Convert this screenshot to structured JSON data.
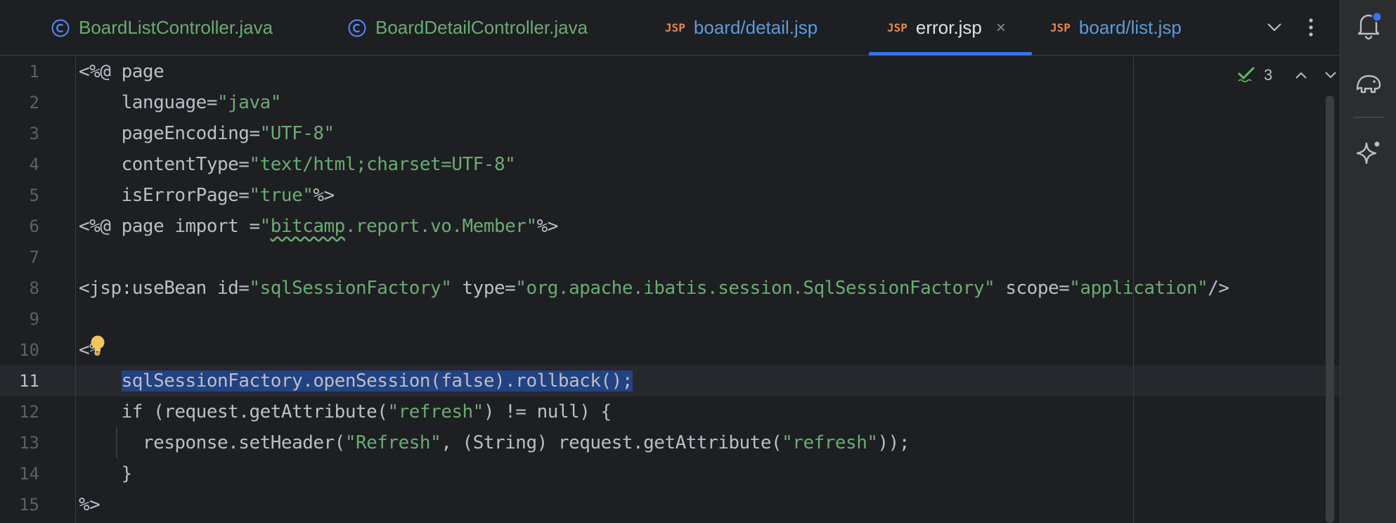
{
  "tabs": [
    {
      "label": "BoardListController.java",
      "type": "java"
    },
    {
      "label": "BoardDetailController.java",
      "type": "java"
    },
    {
      "label": "board/detail.jsp",
      "type": "jsp"
    },
    {
      "label": "error.jsp",
      "type": "jsp",
      "active": true
    },
    {
      "label": "board/list.jsp",
      "type": "jsp"
    }
  ],
  "jsp_icon_text": "JSP",
  "close_glyph": "×",
  "inspection": {
    "count": "3"
  },
  "current_line": 11,
  "lines": [
    {
      "num": "1",
      "text": "<%@ page"
    },
    {
      "num": "2",
      "text": "    language=\"java\""
    },
    {
      "num": "3",
      "text": "    pageEncoding=\"UTF-8\""
    },
    {
      "num": "4",
      "text": "    contentType=\"text/html;charset=UTF-8\""
    },
    {
      "num": "5",
      "text": "    isErrorPage=\"true\"%>"
    },
    {
      "num": "6",
      "text": "<%@ page import =\"bitcamp.report.vo.Member\"%>"
    },
    {
      "num": "7",
      "text": ""
    },
    {
      "num": "8",
      "text": "<jsp:useBean id=\"sqlSessionFactory\" type=\"org.apache.ibatis.session.SqlSessionFactory\" scope=\"application\"/>"
    },
    {
      "num": "9",
      "text": ""
    },
    {
      "num": "10",
      "text": "<%"
    },
    {
      "num": "11",
      "text": "    sqlSessionFactory.openSession(false).rollback();"
    },
    {
      "num": "12",
      "text": "    if (request.getAttribute(\"refresh\") != null) {"
    },
    {
      "num": "13",
      "text": "      response.setHeader(\"Refresh\", (String) request.getAttribute(\"refresh\"));"
    },
    {
      "num": "14",
      "text": "    }"
    },
    {
      "num": "15",
      "text": "%>"
    }
  ],
  "colors": {
    "string": "#6aab73",
    "selection": "#214283",
    "accent": "#3574f0",
    "notification_dot": "#3574f0",
    "bulb": "#f2c55c"
  },
  "icons": {
    "tab_java": "java-class-icon",
    "tab_jsp": "jsp-file-icon",
    "dropdown": "chevron-down-icon",
    "more": "more-vertical-icon",
    "notifications": "bell-icon",
    "database": "database-elephant-icon",
    "ai": "sparkle-icon",
    "inspection": "check-icon",
    "bulb": "lightbulb-icon"
  }
}
